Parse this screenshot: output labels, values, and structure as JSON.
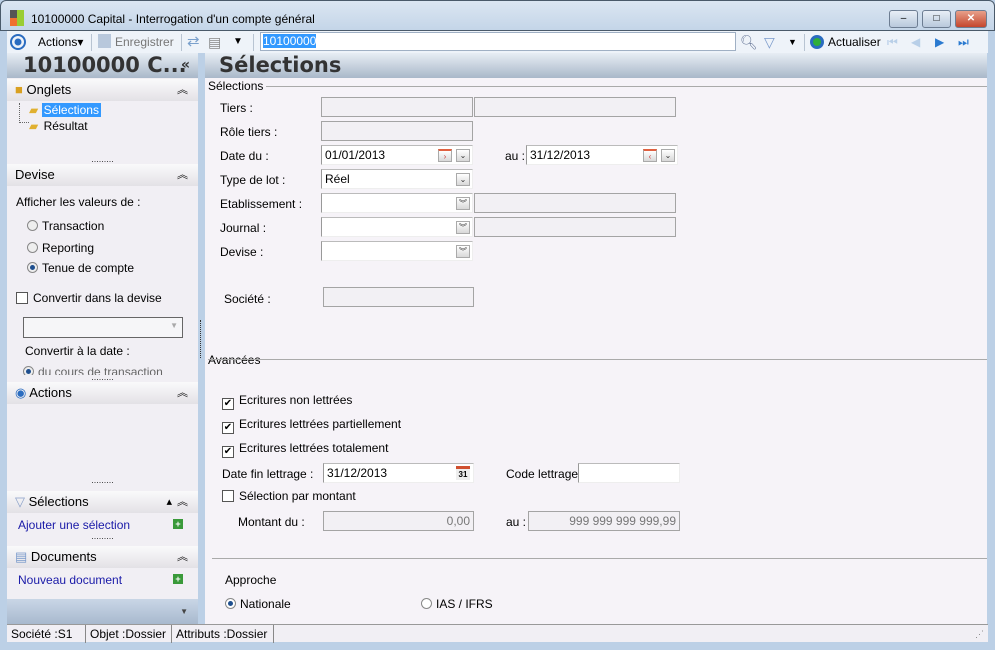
{
  "window": {
    "title": "10100000 Capital -  Interrogation d'un compte général",
    "minimize": "–",
    "maximize": "□",
    "close": "✕"
  },
  "toolbar": {
    "actions_label": "Actions",
    "save_label": "Enregistrer",
    "search_value": "10100000",
    "refresh_label": "Actualiser"
  },
  "left": {
    "header": "10100000 C...",
    "collapse": "«",
    "onglets": {
      "title": "Onglets",
      "items": [
        "Sélections",
        "Résultat"
      ]
    },
    "devise": {
      "title": "Devise",
      "prompt": "Afficher les valeurs de :",
      "options": [
        "Transaction",
        "Reporting",
        "Tenue de compte"
      ],
      "selected": "Tenue de compte",
      "convert_label": "Convertir dans la devise",
      "convert_checked": false,
      "date_label": "Convertir à la date :",
      "date_option": "du cours de transaction"
    },
    "actions": {
      "title": "Actions"
    },
    "selections": {
      "title": "Sélections",
      "link": "Ajouter une sélection"
    },
    "documents": {
      "title": "Documents",
      "link": "Nouveau document"
    }
  },
  "main": {
    "header": "Sélections",
    "group1": "Sélections",
    "fields": {
      "tiers": "Tiers :",
      "role": "Rôle tiers :",
      "date_du": "Date du :",
      "date_du_value": "01/01/2013",
      "au": "au :",
      "date_au_value": "31/12/2013",
      "type_lot": "Type de lot :",
      "type_lot_value": "Réel",
      "etab": "Etablissement :",
      "journal": "Journal :",
      "devise": "Devise :",
      "societe": "Société :"
    },
    "group2": "Avancées",
    "checks": [
      {
        "label": "Ecritures non lettrées",
        "checked": true
      },
      {
        "label": "Ecritures lettrées partiellement",
        "checked": true
      },
      {
        "label": "Ecritures lettrées totalement",
        "checked": true
      }
    ],
    "date_fin": "Date fin lettrage :",
    "date_fin_value": "31/12/2013",
    "cal_day": "31",
    "code_lettrage": "Code lettrage :",
    "sel_montant": {
      "label": "Sélection par montant",
      "checked": false
    },
    "montant_du": "Montant du :",
    "montant_du_value": "0,00",
    "montant_au": "au :",
    "montant_au_value": "999 999 999 999,99",
    "approche": {
      "title": "Approche",
      "options": [
        "Nationale",
        "IAS / IFRS"
      ],
      "selected": "Nationale"
    }
  },
  "status": {
    "societe": "Société :S1",
    "objet": "Objet :Dossier",
    "attributs": "Attributs :Dossier"
  }
}
